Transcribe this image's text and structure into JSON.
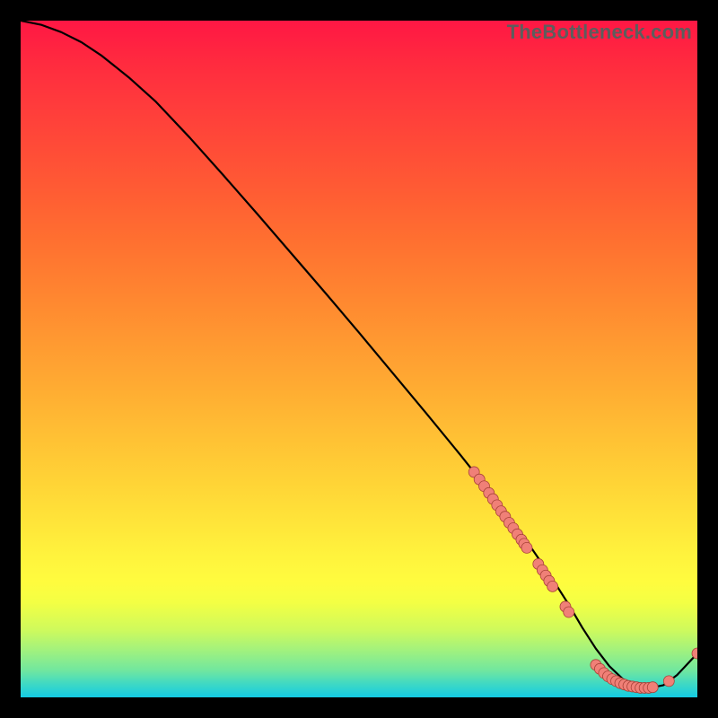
{
  "watermark": "TheBottleneck.com",
  "colors": {
    "curve": "#000000",
    "dot_fill": "#f08077",
    "dot_stroke": "#a84238"
  },
  "chart_data": {
    "type": "line",
    "title": "",
    "xlabel": "",
    "ylabel": "",
    "xlim": [
      0,
      100
    ],
    "ylim": [
      0,
      100
    ],
    "grid": false,
    "series": [
      {
        "name": "bottleneck-curve",
        "x": [
          0,
          3,
          6,
          9,
          12,
          16,
          20,
          25,
          30,
          35,
          40,
          45,
          50,
          55,
          60,
          65,
          70,
          74,
          78,
          81,
          83,
          85,
          87,
          89,
          91,
          93,
          95,
          97,
          100
        ],
        "y": [
          100,
          99.4,
          98.3,
          96.8,
          94.8,
          91.6,
          88.0,
          82.7,
          77.1,
          71.4,
          65.6,
          59.8,
          53.9,
          47.9,
          41.9,
          35.8,
          29.5,
          24.2,
          18.4,
          13.7,
          10.3,
          7.2,
          4.6,
          2.7,
          1.7,
          1.4,
          1.8,
          3.3,
          6.5
        ]
      }
    ],
    "points": [
      {
        "name": "cluster-upper",
        "x": [
          67.0,
          67.8,
          68.5,
          69.2,
          69.8,
          70.4,
          71.0,
          71.6,
          72.2,
          72.8,
          73.4,
          74.0,
          74.4,
          74.8
        ],
        "y": [
          33.3,
          32.2,
          31.2,
          30.2,
          29.3,
          28.4,
          27.5,
          26.7,
          25.8,
          25.0,
          24.1,
          23.3,
          22.7,
          22.1
        ]
      },
      {
        "name": "cluster-mid",
        "x": [
          76.5,
          77.1,
          77.6,
          78.1,
          78.6
        ],
        "y": [
          19.7,
          18.8,
          18.0,
          17.2,
          16.4
        ]
      },
      {
        "name": "cluster-low",
        "x": [
          80.5,
          81.0
        ],
        "y": [
          13.4,
          12.6
        ]
      },
      {
        "name": "valley-floor",
        "x": [
          85.0,
          85.6,
          86.2,
          86.8,
          87.4,
          88.0,
          88.6,
          89.2,
          89.8,
          90.4,
          91.0,
          91.6,
          92.2,
          92.8,
          93.4
        ],
        "y": [
          4.8,
          4.2,
          3.6,
          3.1,
          2.7,
          2.4,
          2.1,
          1.9,
          1.7,
          1.6,
          1.5,
          1.4,
          1.4,
          1.4,
          1.5
        ]
      },
      {
        "name": "tail",
        "x": [
          95.8,
          100.0
        ],
        "y": [
          2.4,
          6.5
        ]
      }
    ]
  }
}
